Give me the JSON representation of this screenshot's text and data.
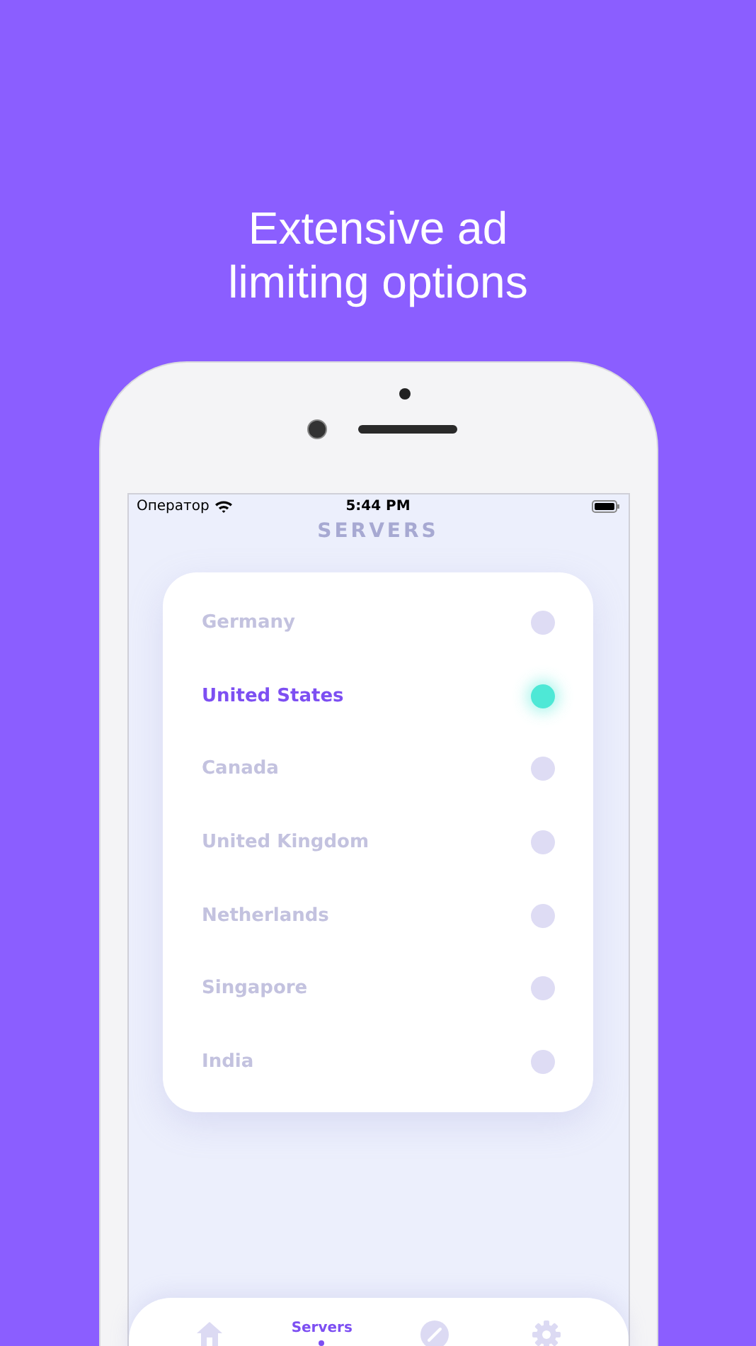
{
  "headline": "Extensive ad limiting options",
  "status_bar": {
    "carrier": "Оператор",
    "time": "5:44 PM"
  },
  "title": "SERVERS",
  "servers": [
    {
      "name": "Germany",
      "selected": false
    },
    {
      "name": "United States",
      "selected": true
    },
    {
      "name": "Canada",
      "selected": false
    },
    {
      "name": "United Kingdom",
      "selected": false
    },
    {
      "name": "Netherlands",
      "selected": false
    },
    {
      "name": "Singapore",
      "selected": false
    },
    {
      "name": "India",
      "selected": false
    }
  ],
  "tabs": [
    {
      "kind": "home",
      "selected": false
    },
    {
      "label": "Servers",
      "selected": true
    },
    {
      "kind": "compass",
      "selected": false
    },
    {
      "kind": "settings",
      "selected": false
    }
  ]
}
